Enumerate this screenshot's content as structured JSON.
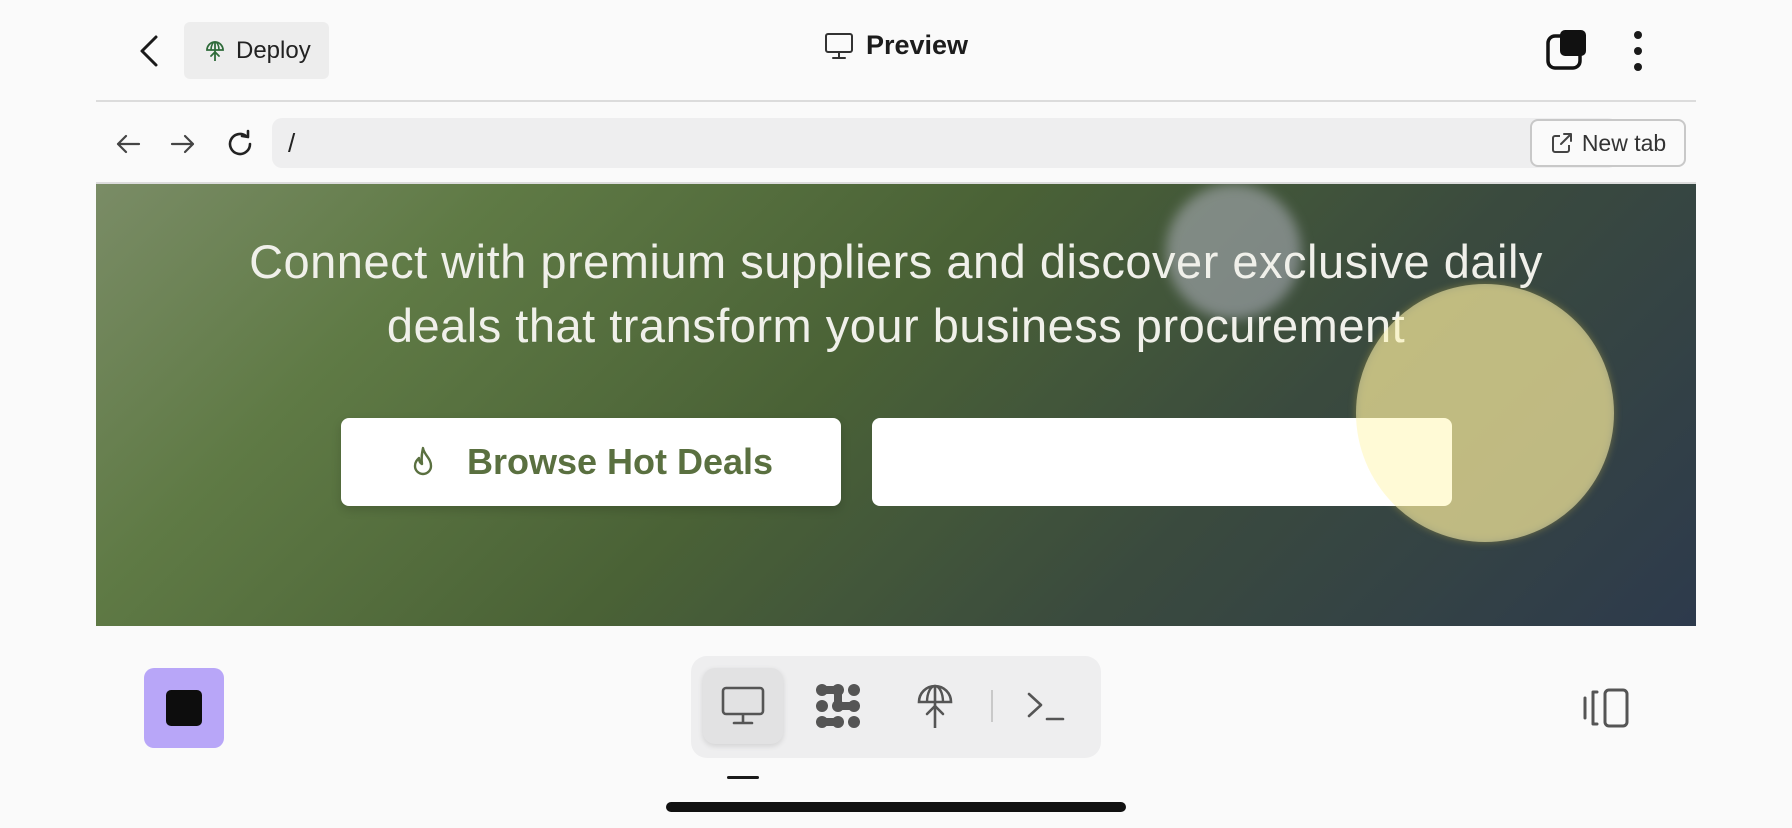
{
  "header": {
    "back_icon": "chevron-left-icon",
    "deploy_label": "Deploy",
    "deploy_icon": "deploy-globe-icon",
    "title": "Preview",
    "title_icon": "monitor-icon",
    "tabs_icon": "tabs-icon",
    "more_icon": "more-vertical-icon"
  },
  "urlbar": {
    "back_icon": "arrow-left-icon",
    "forward_icon": "arrow-right-icon",
    "reload_icon": "reload-icon",
    "url": "/",
    "go_icon": "arrow-right-icon",
    "new_tab_label": "New tab",
    "new_tab_icon": "external-link-icon"
  },
  "hero": {
    "headline_line1": "Connect with premium suppliers and discover exclusive daily",
    "headline_line2": "deals that transform your business procurement",
    "primary_button_label": "Browse Hot Deals",
    "primary_button_icon": "flame-icon",
    "secondary_button_label": ""
  },
  "toolbar": {
    "stop_icon": "stop-icon",
    "accent_color": "#b8a6f8",
    "tools": [
      {
        "name": "preview",
        "icon": "monitor-icon",
        "active": true
      },
      {
        "name": "agent",
        "icon": "agent-icon",
        "active": false
      },
      {
        "name": "deploy",
        "icon": "deploy-globe-icon",
        "active": false
      },
      {
        "name": "console",
        "icon": "terminal-icon",
        "active": false
      }
    ],
    "side_toggle_icon": "panel-toggle-icon"
  },
  "colors": {
    "page_background": "#fafafa",
    "hero_green": "#5f7a45",
    "hero_dark": "#2d3a4c",
    "button_text_green": "#5a7040"
  }
}
